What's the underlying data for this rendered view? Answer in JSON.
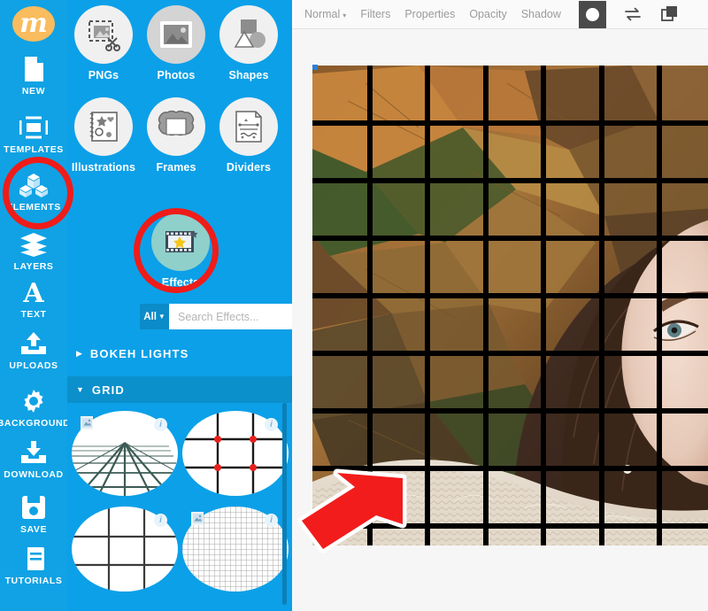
{
  "app": {
    "logo_text": "m",
    "logo_color": "#f9bc5e",
    "accent_blue": "#0ca0e8",
    "annotation_red": "#ef1c19"
  },
  "rail": {
    "items": [
      {
        "label": "NEW",
        "icon": "new-document-icon"
      },
      {
        "label": "TEMPLATES",
        "icon": "templates-icon"
      },
      {
        "label": "ELEMENTS",
        "icon": "elements-cubes-icon"
      },
      {
        "label": "LAYERS",
        "icon": "layers-icon"
      },
      {
        "label": "TEXT",
        "icon": "text-a-icon"
      },
      {
        "label": "UPLOADS",
        "icon": "upload-icon"
      },
      {
        "label": "BACKGROUND",
        "icon": "gear-icon"
      },
      {
        "label": "DOWNLOAD",
        "icon": "download-icon"
      },
      {
        "label": "SAVE",
        "icon": "floppy-save-icon"
      },
      {
        "label": "TUTORIALS",
        "icon": "book-tutorials-icon"
      }
    ]
  },
  "panel": {
    "categories": [
      {
        "label": "PNGs",
        "icon": "png-cutout-icon"
      },
      {
        "label": "Photos",
        "icon": "photo-icon"
      },
      {
        "label": "Shapes",
        "icon": "shapes-icon"
      },
      {
        "label": "Illustrations",
        "icon": "illustrations-icon"
      },
      {
        "label": "Frames",
        "icon": "frame-icon"
      },
      {
        "label": "Dividers",
        "icon": "divider-icon"
      },
      {
        "label": "Effects",
        "icon": "effects-filmstrip-star-icon"
      }
    ],
    "search": {
      "filter_label": "All",
      "placeholder": "Search Effects...",
      "value": ""
    },
    "sections": [
      {
        "label": "BOKEH LIGHTS",
        "expanded": false,
        "marker": "▶"
      },
      {
        "label": "GRID",
        "expanded": true,
        "marker": "▼"
      }
    ],
    "thumbnails": [
      {
        "name": "perspective-grid",
        "info_badge": "i",
        "has_image_badge": true
      },
      {
        "name": "rule-of-thirds-grid-dots",
        "info_badge": "i",
        "has_image_badge": false
      },
      {
        "name": "thirds-grid",
        "info_badge": "i",
        "has_image_badge": false
      },
      {
        "name": "fine-mesh-grid",
        "info_badge": "i",
        "has_image_badge": true
      }
    ]
  },
  "toolbar": {
    "blend_mode": "Normal",
    "caret": "▾",
    "items": [
      "Filters",
      "Properties",
      "Opacity",
      "Shadow"
    ],
    "swatch_name": "color-swatch",
    "icons": [
      "flip-swap-icon",
      "duplicate-layer-icon"
    ]
  },
  "canvas": {
    "image_description": "autumn-leaves-portrait",
    "effect_applied": "grid-overlay",
    "grid_cols": 7,
    "grid_rows": 8,
    "grid_line_color": "#000000"
  },
  "annotations": {
    "highlight_elements": "ELEMENTS",
    "highlight_effects": "Effects",
    "arrow": "red-arrow-pointing-down-left"
  }
}
